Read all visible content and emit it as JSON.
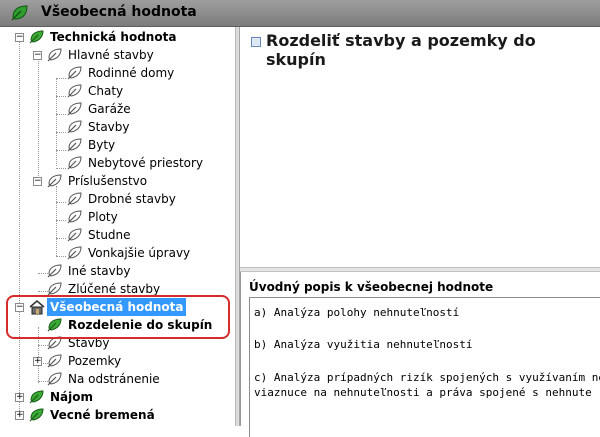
{
  "window": {
    "title": "Všeobecná hodnota",
    "title_icon": "leaf-icon"
  },
  "tree": {
    "nodes": [
      {
        "label": "Technická hodnota"
      },
      {
        "label": "Hlavné stavby"
      },
      {
        "label": "Rodinné domy"
      },
      {
        "label": "Chaty"
      },
      {
        "label": "Garáže"
      },
      {
        "label": "Stavby"
      },
      {
        "label": "Byty"
      },
      {
        "label": "Nebytové priestory"
      },
      {
        "label": "Príslušenstvo"
      },
      {
        "label": "Drobné stavby"
      },
      {
        "label": "Ploty"
      },
      {
        "label": "Studne"
      },
      {
        "label": "Vonkajšie úpravy"
      },
      {
        "label": "Iné stavby"
      },
      {
        "label": "Zlúčené stavby"
      },
      {
        "label": "Všeobecná hodnota"
      },
      {
        "label": "Rozdelenie do skupín"
      },
      {
        "label": "Stavby"
      },
      {
        "label": "Pozemky"
      },
      {
        "label": "Na odstránenie"
      },
      {
        "label": "Nájom"
      },
      {
        "label": "Vecné bremená"
      }
    ],
    "selected": "Všeobecná hodnota",
    "highlight_color": "#d62b2b",
    "selection_color": "#3399ff"
  },
  "right": {
    "heading": "Rozdeliť stavby a pozemky do skupín",
    "panel_title": "Úvodný popis k všeobecnej hodnote",
    "lines": [
      "a) Analýza polohy nehnuteľností",
      "b) Analýza využitia nehnuteľností",
      "c) Analýza prípadných rizík spojených s využívaním ne",
      "viaznuce na nehnuteľnosti a práva spojené s nehnute"
    ]
  }
}
